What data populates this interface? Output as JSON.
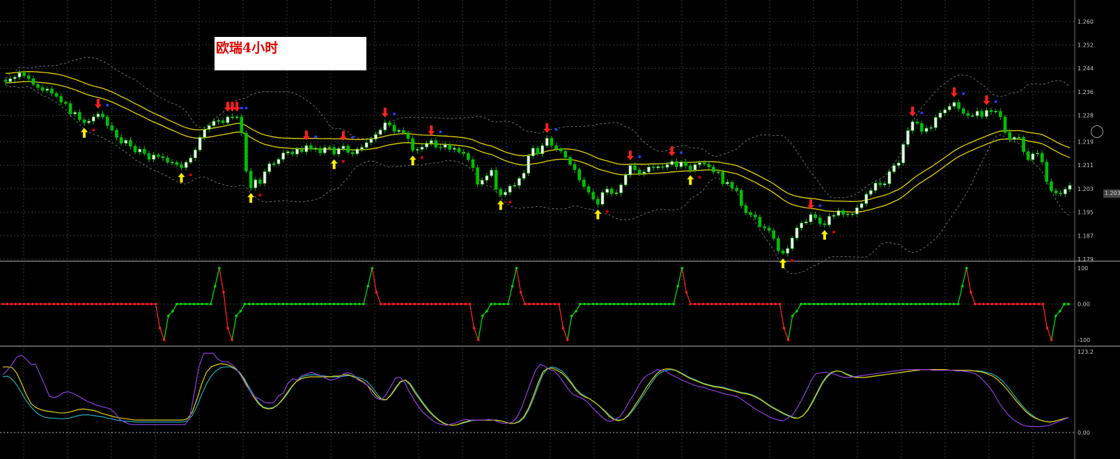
{
  "title": "欧瑞4小时",
  "current_price_label": "1.203",
  "colors": {
    "background": "#000000",
    "grid": "#3a3a3a",
    "bull": "#f0f0f0",
    "bear": "#00c000",
    "ma": "#e6d600",
    "band": "#707070",
    "dot_red": "#e00000",
    "dot_blue": "#2040ff",
    "arrow_red": "#ff2020",
    "arrow_yellow": "#ffee00",
    "osc_up": "#00dd00",
    "osc_down": "#ff2020",
    "stoch_purple": "#9040e0",
    "stoch_yellow": "#e6d600",
    "stoch_cyan": "#20b0c0"
  },
  "chart_data": [
    {
      "type": "candlestick",
      "panel": "price",
      "title": "欧瑞4小时",
      "y_ticks": [
        "1.260",
        "1.252",
        "1.244",
        "1.236",
        "1.228",
        "1.219",
        "1.211",
        "1.203",
        "1.195",
        "1.187",
        "1.179"
      ],
      "ylim": [
        1.179,
        1.264
      ],
      "close": [
        1.2395,
        1.2405,
        1.241,
        1.2425,
        1.2415,
        1.2405,
        1.2385,
        1.2375,
        1.2365,
        1.237,
        1.2355,
        1.2345,
        1.2325,
        1.232,
        1.2285,
        1.229,
        1.2265,
        1.2255,
        1.226,
        1.2275,
        1.2285,
        1.2275,
        1.2245,
        1.223,
        1.2205,
        1.2185,
        1.2195,
        1.2175,
        1.2155,
        1.2165,
        1.215,
        1.213,
        1.2145,
        1.214,
        1.2135,
        1.212,
        1.212,
        1.2112,
        1.2102,
        1.212,
        1.2135,
        1.2162,
        1.2205,
        1.2232,
        1.2245,
        1.226,
        1.2262,
        1.2255,
        1.2275,
        1.2275,
        1.2275,
        1.222,
        1.209,
        1.2033,
        1.206,
        1.2048,
        1.2088,
        1.2115,
        1.2115,
        1.213,
        1.2152,
        1.2156,
        1.2148,
        1.2165,
        1.2156,
        1.2177,
        1.2165,
        1.2168,
        1.2152,
        1.217,
        1.2171,
        1.2148,
        1.2167,
        1.2175,
        1.2154,
        1.2149,
        1.2165,
        1.2171,
        1.2187,
        1.2199,
        1.2215,
        1.223,
        1.2255,
        1.2247,
        1.2225,
        1.2229,
        1.2221,
        1.2201,
        1.2161,
        1.2164,
        1.2172,
        1.2185,
        1.2194,
        1.2172,
        1.2171,
        1.218,
        1.2164,
        1.2168,
        1.2155,
        1.215,
        1.2129,
        1.2102,
        1.2045,
        1.2059,
        1.2074,
        1.2093,
        1.2028,
        1.2009,
        1.2018,
        1.2039,
        1.2041,
        1.2065,
        1.2083,
        1.2142,
        1.2168,
        1.2149,
        1.2177,
        1.2202,
        1.2177,
        1.2165,
        1.2158,
        1.2137,
        1.2113,
        1.2095,
        1.206,
        1.2037,
        1.2018,
        1.1995,
        1.1977,
        1.2017,
        1.2029,
        1.2013,
        1.2016,
        1.2043,
        1.2077,
        1.2109,
        1.2094,
        1.2082,
        1.2087,
        1.2104,
        1.2101,
        1.2105,
        1.2103,
        1.2112,
        1.2123,
        1.2105,
        1.2121,
        1.2108,
        1.2094,
        1.2112,
        1.2118,
        1.2114,
        1.2104,
        1.2087,
        1.2087,
        1.2047,
        1.2052,
        1.2032,
        1.2024,
        1.1972,
        1.1948,
        1.1941,
        1.1933,
        1.1901,
        1.1896,
        1.1887,
        1.186,
        1.1818,
        1.181,
        1.1826,
        1.1862,
        1.1896,
        1.1913,
        1.1917,
        1.1942,
        1.1931,
        1.1911,
        1.1907,
        1.1936,
        1.1939,
        1.1955,
        1.1942,
        1.1944,
        1.1944,
        1.1965,
        1.1979,
        1.2011,
        1.2024,
        1.2049,
        1.2043,
        1.2047,
        1.2088,
        1.2109,
        1.2118,
        1.2181,
        1.2228,
        1.2258,
        1.2253,
        1.2225,
        1.2236,
        1.2238,
        1.2273,
        1.2288,
        1.2299,
        1.2311,
        1.2324,
        1.2303,
        1.2287,
        1.2279,
        1.2279,
        1.2294,
        1.2276,
        1.2297,
        1.2292,
        1.2294,
        1.2275,
        1.2222,
        1.2198,
        1.2205,
        1.2205,
        1.2156,
        1.2129,
        1.2149,
        1.2151,
        1.2121,
        1.2054,
        1.2023,
        1.2015,
        1.2012,
        1.2028,
        1.2041
      ]
    },
    {
      "type": "line",
      "panel": "oscillator",
      "y_ticks": [
        "100",
        "0.00",
        "-100"
      ],
      "ylim": [
        -100,
        100
      ],
      "values": [
        0,
        0,
        0,
        0,
        0,
        0,
        0,
        0,
        0,
        0,
        0,
        0,
        0,
        0,
        0,
        0,
        0,
        0,
        0,
        0,
        0,
        0,
        0,
        0,
        0,
        0,
        0,
        0,
        0,
        0,
        0,
        0,
        0,
        0,
        0,
        0,
        0,
        -67,
        -100,
        -33,
        -20,
        0,
        0,
        0,
        0,
        0,
        0,
        0,
        0,
        0,
        50,
        100,
        33,
        -67,
        -100,
        -33,
        -20,
        0,
        0,
        0,
        0,
        0,
        0,
        0,
        0,
        0,
        0,
        0,
        0,
        0,
        0,
        0,
        0,
        0,
        0,
        0,
        0,
        0,
        0,
        0,
        0,
        0,
        0,
        0,
        0,
        0,
        50,
        100,
        33,
        0,
        0,
        0,
        0,
        0,
        0,
        0,
        0,
        0,
        0,
        0,
        0,
        0,
        0,
        0,
        0,
        0,
        0,
        0,
        0,
        0,
        0,
        -67,
        -100,
        -33,
        -20,
        0,
        0,
        0,
        0,
        0,
        50,
        100,
        33,
        0,
        0,
        0,
        0,
        0,
        0,
        0,
        0,
        0,
        -67,
        -100,
        -33,
        -20,
        0,
        0,
        0,
        0,
        0,
        0,
        0,
        0,
        0,
        0,
        0,
        0,
        0,
        0,
        0,
        0,
        0,
        0,
        0,
        0,
        0,
        0,
        0,
        50,
        100,
        33,
        0,
        0,
        0,
        0,
        0,
        0,
        0,
        0,
        0,
        0,
        0,
        0,
        0,
        0,
        0,
        0,
        0,
        0,
        0,
        0,
        0,
        0,
        -67,
        -100,
        -33,
        -20,
        0,
        0,
        0,
        0,
        0,
        0,
        0,
        0,
        0,
        0,
        0,
        0,
        0,
        0,
        0,
        0,
        0,
        0,
        0,
        0,
        0,
        0,
        0,
        0,
        0,
        0,
        0,
        0,
        0,
        0,
        0,
        0,
        0,
        0,
        0,
        0,
        0,
        0,
        50,
        100,
        33,
        0,
        0,
        0,
        0,
        0,
        0,
        0,
        0,
        0,
        0,
        0,
        0,
        0,
        0,
        0,
        0,
        0,
        -67,
        -100,
        -33,
        -20,
        0,
        0
      ]
    },
    {
      "type": "line",
      "panel": "stochastic",
      "y_ticks": [
        "123.2",
        "0.00"
      ],
      "ylim": [
        0,
        123.2
      ],
      "series": [
        {
          "values": [
            85,
            86,
            81,
            72,
            60,
            48,
            39,
            31,
            26,
            23,
            22,
            22,
            21,
            21,
            22,
            24,
            26,
            27,
            27,
            26,
            25,
            24,
            22,
            21,
            19,
            18,
            17,
            17,
            16,
            16,
            16,
            16,
            16,
            16,
            16,
            16,
            16,
            16,
            16,
            18,
            26,
            40,
            58,
            74,
            86,
            94,
            99,
            100,
            100,
            97,
            92,
            82,
            69,
            57,
            46,
            39,
            37,
            38,
            42,
            49,
            58,
            69,
            78,
            84,
            87,
            88,
            88,
            87,
            86,
            85,
            85,
            85,
            86,
            87,
            86,
            84,
            82,
            77,
            69,
            59,
            51,
            50,
            57,
            67,
            77,
            80,
            75,
            64,
            53,
            43,
            34,
            26,
            20,
            15,
            12,
            11,
            12,
            14,
            16,
            18,
            19,
            19,
            19,
            19,
            19,
            18,
            16,
            14,
            14,
            16,
            22,
            34,
            51,
            70,
            88,
            97,
            100,
            98,
            94,
            87,
            77,
            67,
            60,
            55,
            51,
            46,
            40,
            34,
            27,
            21,
            19,
            20,
            25,
            33,
            43,
            54,
            65,
            76,
            86,
            92,
            95,
            96,
            95,
            92,
            88,
            84,
            81,
            78,
            75,
            73,
            71,
            70,
            69,
            67,
            65,
            63,
            61,
            60,
            58,
            55,
            51,
            46,
            41,
            37,
            33,
            29,
            26,
            23,
            22,
            26,
            34,
            46,
            60,
            74,
            84,
            91,
            94,
            93,
            90,
            87,
            85,
            84,
            84,
            85,
            86,
            87,
            88,
            89,
            90,
            91,
            92,
            93,
            94,
            95,
            96,
            96,
            96,
            96,
            96,
            96,
            95,
            95,
            95,
            95,
            95,
            94,
            94,
            93,
            91,
            89,
            85,
            79,
            71,
            62,
            52,
            43,
            35,
            28,
            23,
            19,
            17,
            16,
            17,
            19,
            21,
            23
          ]
        },
        {
          "values": [
            100,
            100,
            99,
            90,
            74,
            57,
            44,
            38,
            35,
            33,
            32,
            31,
            30,
            30,
            31,
            33,
            35,
            36,
            35,
            34,
            32,
            29,
            27,
            25,
            23,
            22,
            21,
            20,
            19,
            19,
            19,
            19,
            19,
            19,
            19,
            19,
            19,
            19,
            19,
            21,
            31,
            51,
            74,
            92,
            100,
            103,
            105,
            104,
            102,
            98,
            91,
            80,
            66,
            54,
            44,
            38,
            36,
            37,
            42,
            50,
            60,
            70,
            78,
            82,
            84,
            85,
            85,
            85,
            85,
            85,
            86,
            86,
            88,
            88,
            85,
            82,
            78,
            72,
            64,
            55,
            50,
            50,
            58,
            69,
            78,
            80,
            73,
            61,
            51,
            41,
            32,
            25,
            19,
            14,
            12,
            11,
            12,
            15,
            17,
            19,
            19,
            19,
            19,
            19,
            19,
            18,
            16,
            14,
            14,
            17,
            24,
            37,
            55,
            75,
            92,
            98,
            98,
            95,
            91,
            84,
            75,
            65,
            58,
            54,
            51,
            46,
            40,
            33,
            25,
            20,
            18,
            20,
            26,
            36,
            47,
            58,
            70,
            80,
            89,
            95,
            97,
            97,
            95,
            91,
            87,
            83,
            80,
            77,
            74,
            72,
            70,
            69,
            68,
            66,
            64,
            62,
            60,
            59,
            57,
            54,
            50,
            45,
            40,
            36,
            32,
            28,
            25,
            22,
            22,
            26,
            35,
            48,
            62,
            76,
            86,
            92,
            94,
            93,
            89,
            86,
            84,
            84,
            84,
            85,
            86,
            87,
            88,
            89,
            90,
            91,
            92,
            93,
            94,
            95,
            96,
            96,
            96,
            96,
            96,
            96,
            95,
            95,
            95,
            95,
            95,
            94,
            93,
            92,
            89,
            86,
            81,
            74,
            66,
            57,
            48,
            40,
            32,
            26,
            22,
            19,
            17,
            16,
            17,
            19,
            21,
            23
          ]
        },
        {
          "values": [
            88,
            95,
            104,
            115,
            118,
            112,
            104,
            104,
            88,
            72,
            55,
            53,
            56,
            61,
            62,
            60,
            56,
            52,
            48,
            45,
            42,
            40,
            38,
            36,
            30,
            20,
            16,
            13,
            12,
            12,
            12,
            12,
            12,
            12,
            12,
            12,
            12,
            12,
            12,
            12,
            22,
            62,
            101,
            121,
            121,
            121,
            112,
            108,
            108,
            104,
            97,
            86,
            73,
            62,
            54,
            51,
            46,
            45,
            46,
            56,
            60,
            75,
            82,
            80,
            87,
            89,
            92,
            89,
            87,
            83,
            80,
            81,
            84,
            90,
            91,
            88,
            80,
            77,
            72,
            59,
            52,
            50,
            58,
            70,
            83,
            84,
            76,
            62,
            50,
            39,
            30,
            24,
            18,
            14,
            12,
            11,
            13,
            15,
            18,
            20,
            19,
            19,
            19,
            19,
            20,
            19,
            16,
            14,
            14,
            16,
            23,
            38,
            58,
            77,
            95,
            104,
            101,
            96,
            94,
            86,
            76,
            66,
            58,
            55,
            52,
            47,
            39,
            32,
            25,
            19,
            17,
            20,
            24,
            34,
            47,
            58,
            71,
            82,
            88,
            91,
            96,
            95,
            93,
            88,
            85,
            81,
            78,
            75,
            72,
            70,
            69,
            66,
            64,
            62,
            60,
            58,
            57,
            55,
            51,
            46,
            41,
            36,
            32,
            28,
            24,
            21,
            19,
            18,
            22,
            27,
            38,
            51,
            65,
            80,
            90,
            91,
            92,
            90,
            89,
            86,
            84,
            84,
            85,
            86,
            87,
            88,
            89,
            90,
            91,
            92,
            93,
            94,
            95,
            96,
            96,
            96,
            96,
            96,
            96,
            95,
            95,
            95,
            95,
            95,
            94,
            94,
            93,
            92,
            90,
            85,
            78,
            70,
            60,
            47,
            37,
            28,
            21,
            16,
            12,
            10,
            9,
            9,
            9,
            10,
            11,
            14,
            17,
            20,
            23
          ]
        }
      ]
    }
  ]
}
